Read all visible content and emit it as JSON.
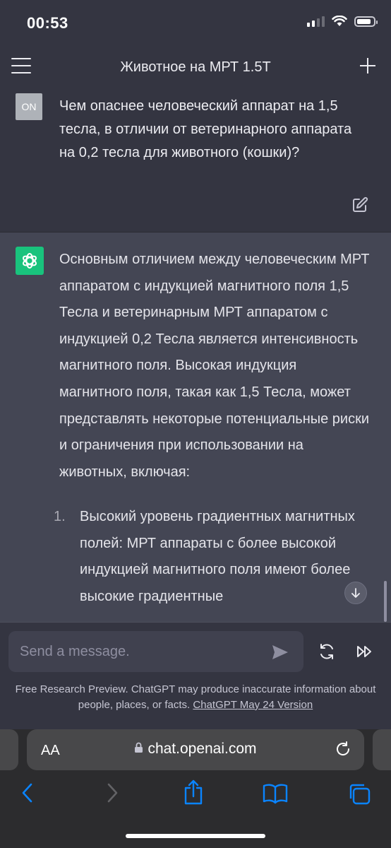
{
  "status_bar": {
    "time": "00:53"
  },
  "header": {
    "title": "Животное на МРТ 1.5Т"
  },
  "user_message": {
    "avatar_initials": "ON",
    "text": "Чем опаснее человеческий аппарат на 1,5 тесла,  в отличии от ветеринарного аппарата на 0,2 тесла для животного (кошки)?"
  },
  "assistant_message": {
    "paragraph": "Основным отличием между человеческим МРТ аппаратом с индукцией магнитного поля 1,5 Тесла и ветеринарным МРТ аппаратом с индукцией 0,2 Тесла является интенсивность магнитного поля. Высокая индукция магнитного поля, такая как 1,5 Тесла, может представлять некоторые потенциальные риски и ограничения при использовании на животных, включая:",
    "list": [
      {
        "number": "1.",
        "text": "Высокий уровень градиентных магнитных полей: МРТ аппараты с более высокой индукцией магнитного поля имеют более высокие градиентные"
      }
    ]
  },
  "composer": {
    "placeholder": "Send a message.",
    "disclaimer": "Free Research Preview. ChatGPT may produce inaccurate information about people, places, or facts.",
    "version_link": "ChatGPT May 24 Version"
  },
  "browser": {
    "text_size_label": "AA",
    "url": "chat.openai.com"
  },
  "colors": {
    "background": "#343541",
    "assistant_background": "#444654",
    "openai_green": "#19c37d"
  }
}
